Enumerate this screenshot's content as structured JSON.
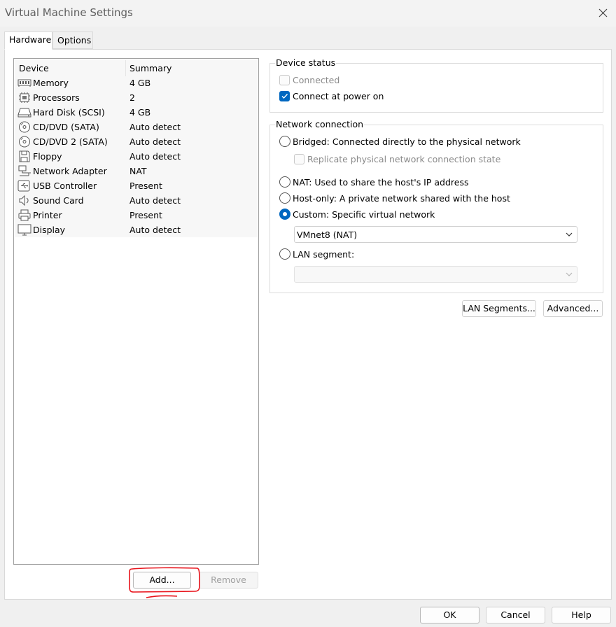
{
  "window": {
    "title": "Virtual Machine Settings"
  },
  "tabs": [
    {
      "label": "Hardware"
    },
    {
      "label": "Options"
    }
  ],
  "device_list": {
    "columns": {
      "device": "Device",
      "summary": "Summary"
    },
    "rows": [
      {
        "name": "Memory",
        "summary": "4 GB",
        "icon": "memory-icon"
      },
      {
        "name": "Processors",
        "summary": "2",
        "icon": "processor-icon"
      },
      {
        "name": "Hard Disk (SCSI)",
        "summary": "4 GB",
        "icon": "hard-disk-icon"
      },
      {
        "name": "CD/DVD (SATA)",
        "summary": "Auto detect",
        "icon": "cd-dvd-icon"
      },
      {
        "name": "CD/DVD 2 (SATA)",
        "summary": "Auto detect",
        "icon": "cd-dvd-icon"
      },
      {
        "name": "Floppy",
        "summary": "Auto detect",
        "icon": "floppy-icon"
      },
      {
        "name": "Network Adapter",
        "summary": "NAT",
        "icon": "network-adapter-icon"
      },
      {
        "name": "USB Controller",
        "summary": "Present",
        "icon": "usb-icon"
      },
      {
        "name": "Sound Card",
        "summary": "Auto detect",
        "icon": "speaker-icon"
      },
      {
        "name": "Printer",
        "summary": "Present",
        "icon": "printer-icon"
      },
      {
        "name": "Display",
        "summary": "Auto detect",
        "icon": "monitor-icon"
      }
    ]
  },
  "list_buttons": {
    "add": "Add...",
    "remove": "Remove"
  },
  "device_status": {
    "legend": "Device status",
    "connected": {
      "label": "Connected",
      "checked": false,
      "enabled": false
    },
    "connect_at_power_on": {
      "label": "Connect at power on",
      "checked": true,
      "enabled": true
    }
  },
  "network_connection": {
    "legend": "Network connection",
    "bridged": "Bridged: Connected directly to the physical network",
    "replicate": "Replicate physical network connection state",
    "nat": "NAT: Used to share the host's IP address",
    "host_only": "Host-only: A private network shared with the host",
    "custom": "Custom: Specific virtual network",
    "custom_selected_value": "VMnet8 (NAT)",
    "lan_segment": "LAN segment:",
    "lan_segment_value": "",
    "selected": "custom"
  },
  "network_buttons": {
    "lan_segments": "LAN Segments...",
    "advanced": "Advanced..."
  },
  "dialog_buttons": {
    "ok": "OK",
    "cancel": "Cancel",
    "help": "Help"
  },
  "colors": {
    "accent": "#0067c0",
    "annotation": "#e8141c"
  }
}
